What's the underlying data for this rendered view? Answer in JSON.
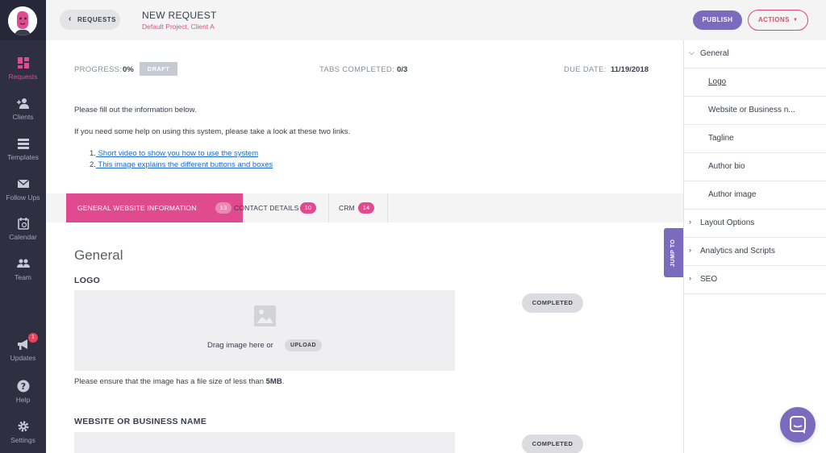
{
  "sidebar": {
    "items": [
      {
        "label": "Requests",
        "icon": "grid-icon"
      },
      {
        "label": "Clients",
        "icon": "user-add-icon"
      },
      {
        "label": "Templates",
        "icon": "templates-icon"
      },
      {
        "label": "Follow Ups",
        "icon": "envelope-icon"
      },
      {
        "label": "Calendar",
        "icon": "calendar-icon"
      },
      {
        "label": "Team",
        "icon": "team-icon"
      },
      {
        "label": "Updates",
        "icon": "megaphone-icon",
        "badge": "1"
      },
      {
        "label": "Help",
        "icon": "help-icon"
      },
      {
        "label": "Settings",
        "icon": "gear-icon"
      }
    ]
  },
  "header": {
    "back_label": "REQUESTS",
    "title": "NEW REQUEST",
    "subtitle": "Default Project, Client A",
    "publish_label": "PUBLISH",
    "actions_label": "ACTIONS"
  },
  "meta": {
    "progress_label": "PROGRESS:",
    "progress_value": "0%",
    "status_badge": "DRAFT",
    "tabs_label": "TABS COMPLETED:",
    "tabs_value": "0/3",
    "due_label": "DUE DATE:",
    "due_value": "11/19/2018"
  },
  "intro": {
    "line1": "Please fill out the information below.",
    "line2": "If you need some help on using this system, please take a look at these two links.",
    "links": [
      {
        "num": "1.",
        "text": " Short video to show you how to use the system "
      },
      {
        "num": "2.",
        "text": " This image explains the different buttons and boxes "
      }
    ]
  },
  "tabs": [
    {
      "label": "GENERAL WEBSITE INFORMATION",
      "count": "13"
    },
    {
      "label": "CONTACT DETAILS",
      "count": "10"
    },
    {
      "label": "CRM",
      "count": "14"
    }
  ],
  "jump_label": "JUMP TO",
  "form": {
    "section_title": "General",
    "logo_title": "LOGO",
    "drag_text": "Drag image here or",
    "upload_label": "UPLOAD",
    "completed_label": "COMPLETED",
    "note_prefix": "Please ensure that the image has a file size of less than ",
    "note_bold": "5MB",
    "note_suffix": ".",
    "website_title": "WEBSITE OR BUSINESS NAME",
    "completed_label_2": "COMPLETED"
  },
  "right_panel": {
    "general": "General",
    "general_items": [
      "Logo",
      "Website or Business n...",
      "Tagline",
      "Author bio",
      "Author image"
    ],
    "groups": [
      "Layout Options",
      "Analytics and Scripts",
      "SEO"
    ]
  },
  "colors": {
    "accent_pink": "#e04a8e",
    "accent_purple": "#7b6bbf",
    "sidebar_bg": "#2e3042",
    "link_blue": "#1e6ac8"
  }
}
